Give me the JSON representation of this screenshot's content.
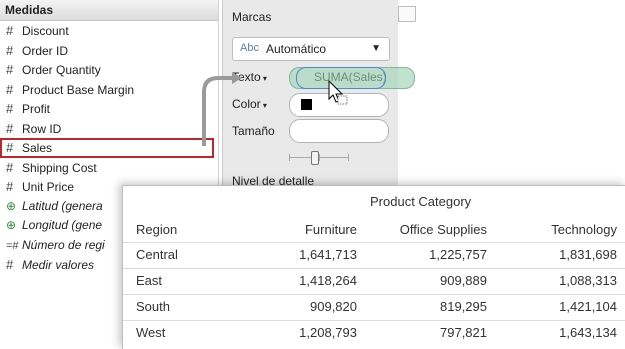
{
  "medidas": {
    "header": "Medidas",
    "items": [
      {
        "icon": "#",
        "label": "Discount",
        "italic": false
      },
      {
        "icon": "#",
        "label": "Order ID",
        "italic": false
      },
      {
        "icon": "#",
        "label": "Order Quantity",
        "italic": false
      },
      {
        "icon": "#",
        "label": "Product Base Margin",
        "italic": false
      },
      {
        "icon": "#",
        "label": "Profit",
        "italic": false
      },
      {
        "icon": "#",
        "label": "Row ID",
        "italic": false
      },
      {
        "icon": "#",
        "label": "Sales",
        "italic": false
      },
      {
        "icon": "#",
        "label": "Shipping Cost",
        "italic": false
      },
      {
        "icon": "#",
        "label": "Unit Price",
        "italic": false
      },
      {
        "icon": "⊕",
        "label": "Latitud (genera",
        "italic": true
      },
      {
        "icon": "⊕",
        "label": "Longitud (gene",
        "italic": true
      },
      {
        "icon": "=#",
        "label": "Número de regi",
        "italic": true
      },
      {
        "icon": "#",
        "label": "Medir valores",
        "italic": true
      }
    ]
  },
  "marcas": {
    "title": "Marcas",
    "abc": "Abc",
    "type_value": "Automático",
    "texto_label": "Texto",
    "color_label": "Color",
    "tamano_label": "Tamaño",
    "nivel_label": "Nivel de detalle",
    "swatch_color": "#000000"
  },
  "drag": {
    "pill_text": "SUMA(Sales)"
  },
  "table": {
    "group_header": "Product Category",
    "row_header": "Region",
    "columns": [
      "Furniture",
      "Office Supplies",
      "Technology"
    ],
    "rows": [
      {
        "region": "Central",
        "values": [
          "1,641,713",
          "1,225,757",
          "1,831,698"
        ]
      },
      {
        "region": "East",
        "values": [
          "1,418,264",
          "909,889",
          "1,088,313"
        ]
      },
      {
        "region": "South",
        "values": [
          "909,820",
          "819,295",
          "1,421,104"
        ]
      },
      {
        "region": "West",
        "values": [
          "1,208,793",
          "797,821",
          "1,643,134"
        ]
      }
    ]
  }
}
